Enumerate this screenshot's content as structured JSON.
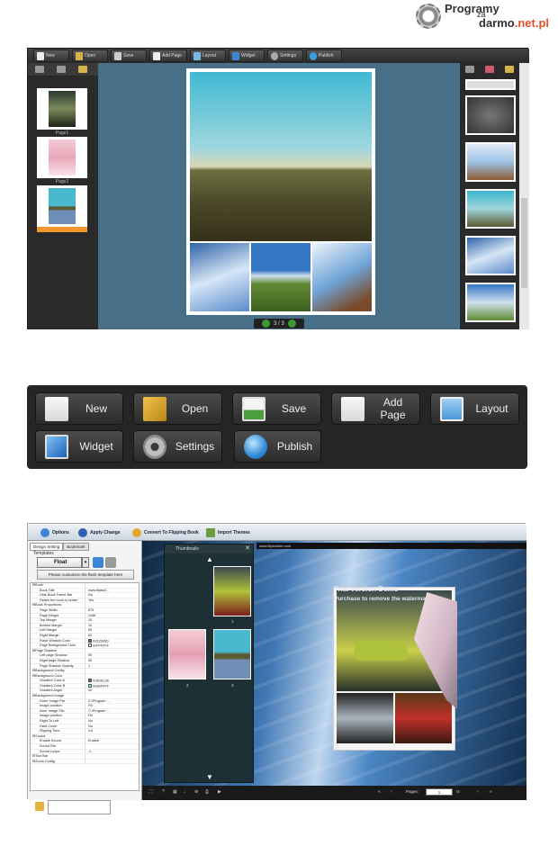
{
  "watermark": {
    "line1": "Programy",
    "line2": "za",
    "line3a": "darmo",
    "line3b": ".net.pl"
  },
  "editor": {
    "toolbar": [
      "New",
      "Open",
      "Save",
      "Add Page",
      "Layout",
      "Widget",
      "Settings",
      "Publish"
    ],
    "thumbs": [
      {
        "label": "Page1"
      },
      {
        "label": "Page2"
      },
      {
        "label": ""
      }
    ],
    "pager": "3 / 3"
  },
  "toolbar_large": {
    "row1": [
      "New",
      "Open",
      "Save",
      "Add Page",
      "Layout"
    ],
    "row2": [
      "Widget",
      "Settings",
      "Publish"
    ]
  },
  "designer": {
    "menu": [
      "Options",
      "Apply Change",
      "Convert To Flipping Book",
      "Import Themes"
    ],
    "tabs": [
      "Design Setting",
      "Bookmark"
    ],
    "templates_label": "Templates",
    "template_value": "Float",
    "customize_button": "Please customize the flash template here",
    "properties": [
      {
        "key": "⊟Book",
        "value": "",
        "cat": true
      },
      {
        "key": "Book Title",
        "value": "www.flipbuil..."
      },
      {
        "key": "Hide Book Frame Bar",
        "value": "No"
      },
      {
        "key": "Retain the book to center",
        "value": "Yes"
      },
      {
        "key": "⊟Book Proportions",
        "value": "",
        "cat": true
      },
      {
        "key": "Page Width",
        "value": "876"
      },
      {
        "key": "Page Height",
        "value": "1168"
      },
      {
        "key": "Top Margin",
        "value": "10"
      },
      {
        "key": "Bottom Margin",
        "value": "10"
      },
      {
        "key": "Left Margin",
        "value": "60"
      },
      {
        "key": "Right Margin",
        "value": "60"
      },
      {
        "key": "Flash Window Color",
        "value": "0x515A5D",
        "color": "#515A5D"
      },
      {
        "key": "Page Background Color",
        "value": "0xFFFFFF",
        "color": "#FFFFFF"
      },
      {
        "key": "⊟Page Shadow",
        "value": "",
        "cat": true
      },
      {
        "key": "Left page Shadow",
        "value": "90"
      },
      {
        "key": "Right page Shadow",
        "value": "55"
      },
      {
        "key": "Page Shadow Opacity",
        "value": "1"
      },
      {
        "key": "⊟Background Config",
        "value": "",
        "cat": true
      },
      {
        "key": "⊟Background Color",
        "value": "",
        "cat": true
      },
      {
        "key": "Gradient Color A",
        "value": "0x5D6C2E",
        "color": "#5D6C2E"
      },
      {
        "key": "Gradient Color B",
        "value": "0x6AFFFF",
        "color": "#6AFFFF"
      },
      {
        "key": "Gradient Angle",
        "value": "90"
      },
      {
        "key": "⊟Background Image",
        "value": "",
        "cat": true
      },
      {
        "key": "Outer Image File",
        "value": "C:\\Program ..."
      },
      {
        "key": "Image position",
        "value": "Fill"
      },
      {
        "key": "Inner Image File",
        "value": "C:\\Program ..."
      },
      {
        "key": "Image position",
        "value": "Fill"
      },
      {
        "key": "Right To Left",
        "value": "No"
      },
      {
        "key": "Hard Cover",
        "value": "No"
      },
      {
        "key": "Flipping Time",
        "value": "0.6"
      },
      {
        "key": "⊟Sound",
        "value": "",
        "cat": true
      },
      {
        "key": "Enable Sound",
        "value": "Enable"
      },
      {
        "key": "Sound File",
        "value": ""
      },
      {
        "key": "Sound Loops",
        "value": "-1"
      },
      {
        "key": "⊟Tool Bar",
        "value": "",
        "cat": true
      },
      {
        "key": "⊟Zoom Config",
        "value": "",
        "cat": true
      }
    ],
    "thumbnails_title": "Thumbnails",
    "thumb_labels": [
      "1",
      "2",
      "3"
    ],
    "url": "www.flipbuilder.com",
    "demo_line1": "Trial version Demo",
    "demo_line2": "Purchase to remove the watermark",
    "pages_label": "Pages:",
    "page_input": "1",
    "page_total": "/4"
  },
  "colors": {
    "stage": "#486F88",
    "panel": "#2A2A2A",
    "accent_orange": "#F3962E",
    "accent_green": "#3C9A2E"
  }
}
